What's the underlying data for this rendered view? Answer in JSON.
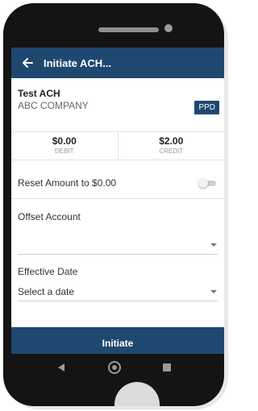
{
  "app_bar": {
    "title": "Initiate ACH..."
  },
  "ach": {
    "name": "Test ACH",
    "company": "ABC COMPANY",
    "badge": "PPD"
  },
  "totals": {
    "debit_amount": "$0.00",
    "debit_label": "DEBIT",
    "credit_amount": "$2.00",
    "credit_label": "CREDIT"
  },
  "reset": {
    "label": "Reset Amount to $0.00",
    "enabled": false
  },
  "offset_account": {
    "label": "Offset Account",
    "value": ""
  },
  "effective_date": {
    "label": "Effective Date",
    "value": "Select a date"
  },
  "actions": {
    "initiate_label": "Initiate"
  },
  "colors": {
    "primary": "#1f4871",
    "background": "#ffffff",
    "device": "#141414"
  },
  "icons": {
    "back": "arrow-left-icon",
    "dropdown": "caret-down-icon",
    "nav_back": "triangle-left-icon",
    "nav_home": "circle-icon",
    "nav_recent": "square-icon"
  }
}
